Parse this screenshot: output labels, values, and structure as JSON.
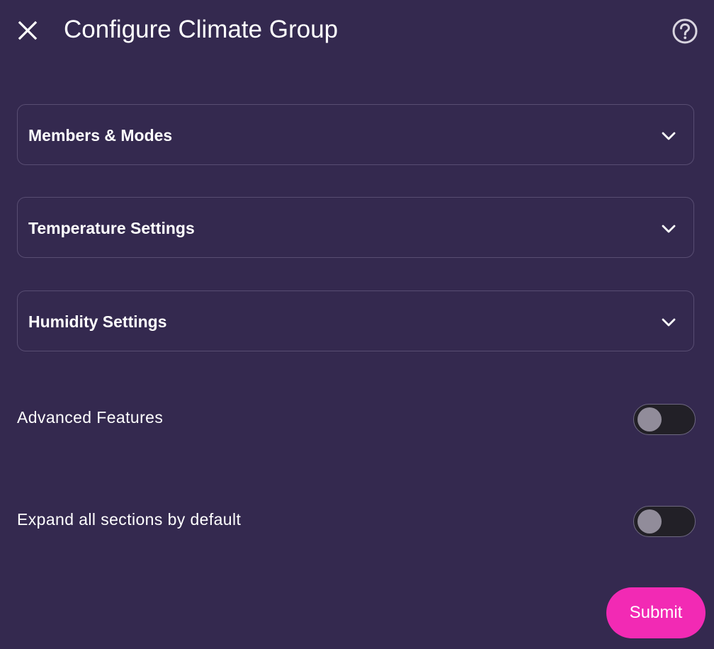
{
  "header": {
    "title": "Configure Climate Group",
    "close_icon": "close-icon",
    "help_icon": "help-circle-icon"
  },
  "sections": [
    {
      "label": "Members & Modes",
      "icon": "chevron-down-icon",
      "expanded": false
    },
    {
      "label": "Temperature Settings",
      "icon": "chevron-down-icon",
      "expanded": false
    },
    {
      "label": "Humidity Settings",
      "icon": "chevron-down-icon",
      "expanded": false
    }
  ],
  "toggles": [
    {
      "label": "Advanced Features",
      "on": false
    },
    {
      "label": "Expand all sections by default",
      "on": false
    }
  ],
  "footer": {
    "submit_label": "Submit"
  },
  "colors": {
    "background": "#34294f",
    "accent": "#f22ab4",
    "border": "#584d72",
    "switch_track": "#222027",
    "switch_knob": "#918c9a"
  }
}
